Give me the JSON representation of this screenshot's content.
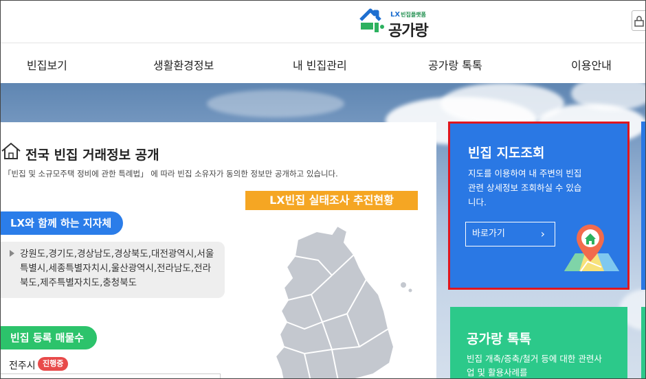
{
  "header": {
    "logo_sub_brand": "LX",
    "logo_sub": "빈집플랫폼",
    "logo_main": "공가랑"
  },
  "nav": {
    "items": [
      {
        "label": "빈집보기"
      },
      {
        "label": "생활환경정보"
      },
      {
        "label": "내 빈집관리"
      },
      {
        "label": "공가랑 톡톡"
      },
      {
        "label": "이용안내"
      }
    ]
  },
  "left_panel": {
    "title": "전국 빈집 거래정보 공개",
    "description": "「빈집 및 소규모주택 정비에 관한 특례법」 에 따라 빈집 소유자가 동의한 정보만 공개하고 있습니다.",
    "survey_tag": "LX빈집 실태조사 추진현황",
    "partner_pill": "LX와 함께 하는 지자체",
    "partner_regions": "강원도,경기도,경상남도,경상북도,대전광역시,서울특별시,세종특별자치시,울산광역시,전라남도,전라북도,제주특별자치도,충청북도",
    "registered_pill": "빈집 등록 매물수",
    "city": "전주시",
    "status_badge": "진행중"
  },
  "map_card": {
    "title": "빈집 지도조회",
    "description": "지도를 이용하여 내 주변의 빈집관련 상세정보 조회하실 수 있습니다.",
    "button_label": "바로가기",
    "button_icon": "chevron-right-icon"
  },
  "talk_card": {
    "title": "공가랑 톡톡",
    "description": "빈집 개축/증축/철거 등에 대한 관련사업 및 활용사례를"
  },
  "colors": {
    "accent_blue": "#2a78e4",
    "accent_green": "#2cc98a",
    "tag_orange": "#f5a623",
    "highlight_red": "#e0161e"
  }
}
